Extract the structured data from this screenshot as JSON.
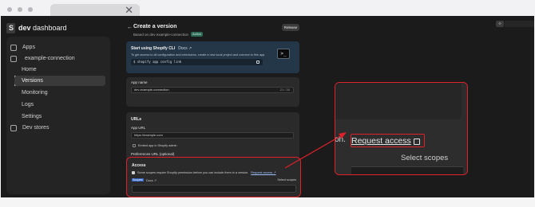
{
  "browser": {
    "tab_close_glyph": "✕"
  },
  "sidebar": {
    "brand_bold": "dev",
    "brand_rest": " dashboard",
    "items": [
      {
        "label": "Apps",
        "icon": "apps-icon"
      },
      {
        "label": "example-connection",
        "icon": "app-icon"
      },
      {
        "label": "Home"
      },
      {
        "label": "Versions",
        "active": true
      },
      {
        "label": "Monitoring"
      },
      {
        "label": "Logs"
      },
      {
        "label": "Settings"
      },
      {
        "label": "Dev stores",
        "icon": "store-icon"
      }
    ]
  },
  "header": {
    "back_glyph": "←",
    "title": "Create a version",
    "subtitle": "Based on dev example-connection",
    "badge": "Active",
    "release_label": "Release"
  },
  "cli": {
    "title": "Start using Shopify CLI",
    "docs": "Docs ↗",
    "description": "To get access to all configuration and extensions, create a new local project and connect to this app.",
    "command": "$ shopify app config link",
    "terminal_glyph": ">_"
  },
  "app_name": {
    "label": "App name",
    "value": "dev-example-connection",
    "count": "21 / 30"
  },
  "urls": {
    "title": "URLs",
    "app_url_label": "App URL",
    "app_url_value": "https://example.com",
    "embed_label": "Embed app in Shopify admin",
    "preferences_label": "Preferences URL (optional)"
  },
  "access": {
    "title": "Access",
    "note": "Some scopes require Shopify permission before you can include them in a version.",
    "request_link": "Request access ↗",
    "scopes_label": "Scopes",
    "scopes_docs": "Docs ↗",
    "select_scopes": "Select scopes"
  },
  "topright": {
    "button_glyph": "‹›"
  },
  "zoom": {
    "prefix": "on.",
    "link": "Request access",
    "select_scopes": "Select scopes"
  },
  "colors": {
    "highlight": "#e0202a",
    "app_background": "#1b1b1b",
    "cli_card": "#243748"
  }
}
